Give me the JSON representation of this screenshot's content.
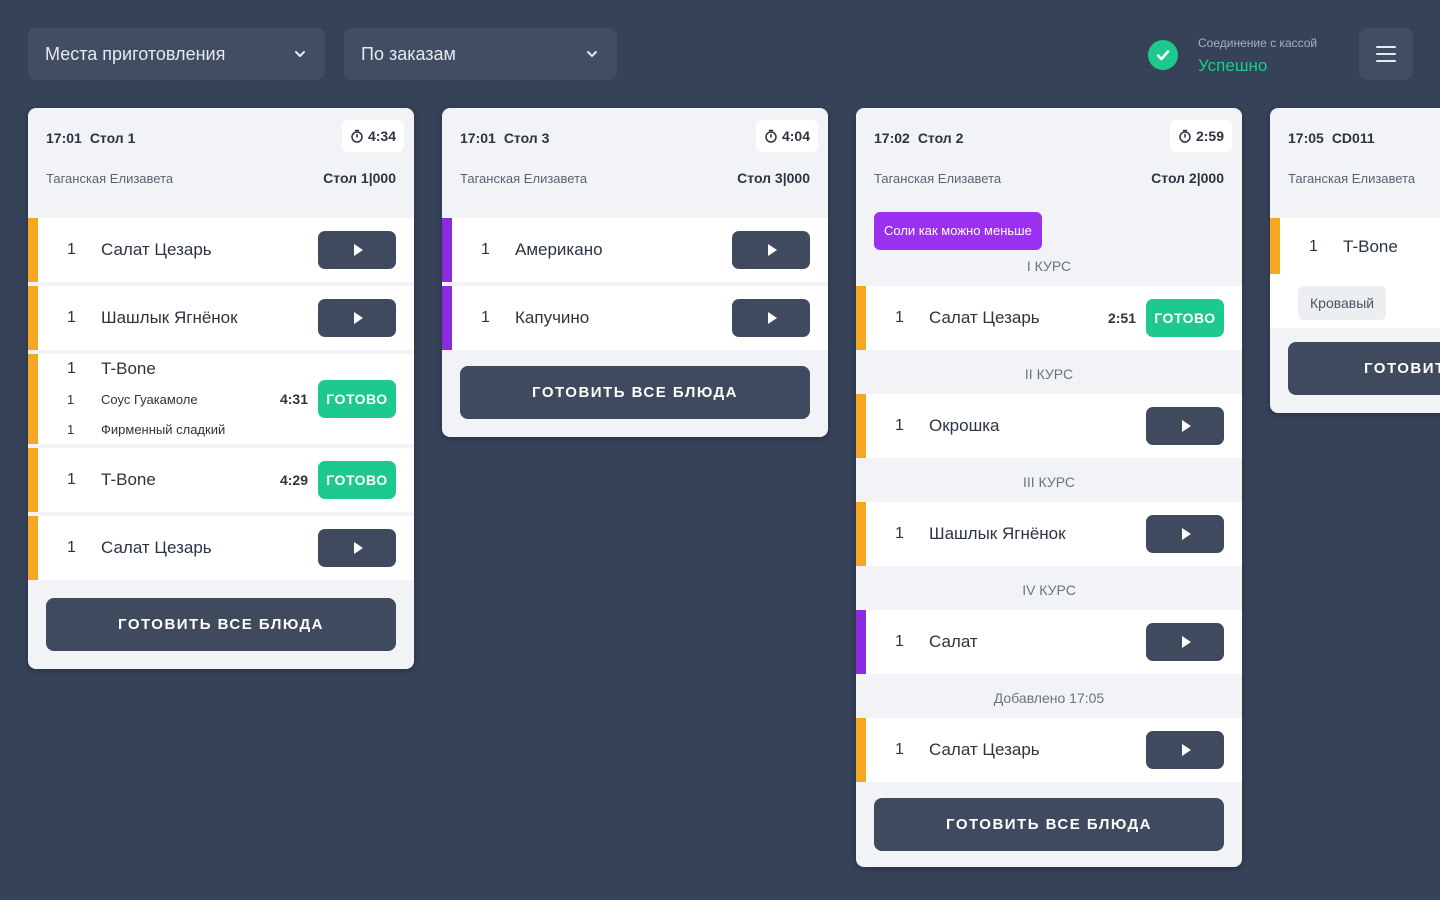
{
  "header": {
    "filter_places": "Места приготовления",
    "filter_mode": "По заказам",
    "connection_label": "Соединение с кассой",
    "connection_status": "Успешно"
  },
  "colors": {
    "background": "#364258",
    "accent_orange": "#f5a623",
    "accent_purple": "#8a2be2",
    "ready_green": "#1ec98d",
    "button_dark": "#3f4a5f"
  },
  "cook_all_label": "ГОТОВИТЬ ВСЕ БЛЮДА",
  "ready_label": "ГОТОВО",
  "orders": [
    {
      "time": "17:01",
      "table": "Стол 1",
      "timer": "4:34",
      "waiter": "Таганская Елизавета",
      "table_code": "Стол 1|000",
      "items": [
        {
          "qty": "1",
          "name": "Салат Цезарь",
          "state": "pending",
          "color": "orange"
        },
        {
          "qty": "1",
          "name": "Шашлык Ягнёнок",
          "state": "pending",
          "color": "orange"
        },
        {
          "qty": "1",
          "name": "T-Bone",
          "state": "ready",
          "elapsed": "4:31",
          "color": "orange",
          "sub_items": [
            {
              "qty": "1",
              "name": "Соус Гуакамоле"
            },
            {
              "qty": "1",
              "name": "Фирменный сладкий"
            }
          ]
        },
        {
          "qty": "1",
          "name": "T-Bone",
          "state": "ready",
          "elapsed": "4:29",
          "color": "orange"
        },
        {
          "qty": "1",
          "name": "Салат Цезарь",
          "state": "pending",
          "color": "orange"
        }
      ]
    },
    {
      "time": "17:01",
      "table": "Стол 3",
      "timer": "4:04",
      "waiter": "Таганская Елизавета",
      "table_code": "Стол 3|000",
      "items": [
        {
          "qty": "1",
          "name": "Американо",
          "state": "pending",
          "color": "purple"
        },
        {
          "qty": "1",
          "name": "Капучино",
          "state": "pending",
          "color": "purple"
        }
      ]
    },
    {
      "time": "17:02",
      "table": "Стол 2",
      "timer": "2:59",
      "waiter": "Таганская Елизавета",
      "table_code": "Стол 2|000",
      "note": "Соли как можно меньше",
      "courses": [
        {
          "label": "I КУРС",
          "items": [
            {
              "qty": "1",
              "name": "Салат Цезарь",
              "state": "ready",
              "elapsed": "2:51",
              "color": "orange"
            }
          ]
        },
        {
          "label": "II КУРС",
          "items": [
            {
              "qty": "1",
              "name": "Окрошка",
              "state": "pending",
              "color": "orange"
            }
          ]
        },
        {
          "label": "III КУРС",
          "items": [
            {
              "qty": "1",
              "name": "Шашлык Ягнёнок",
              "state": "pending",
              "color": "orange"
            }
          ]
        },
        {
          "label": "IV КУРС",
          "items": [
            {
              "qty": "1",
              "name": "Салат",
              "state": "pending",
              "color": "purple"
            }
          ]
        },
        {
          "label": "Добавлено 17:05",
          "items": [
            {
              "qty": "1",
              "name": "Салат Цезарь",
              "state": "pending",
              "color": "orange"
            }
          ]
        }
      ]
    },
    {
      "time": "17:05",
      "table": "CD011",
      "waiter": "Таганская Елизавета",
      "items": [
        {
          "qty": "1",
          "name": "T-Bone",
          "modifier": "Кровавый",
          "color": "orange"
        }
      ],
      "cook_label_partial": "ГОТОВИТ"
    }
  ]
}
